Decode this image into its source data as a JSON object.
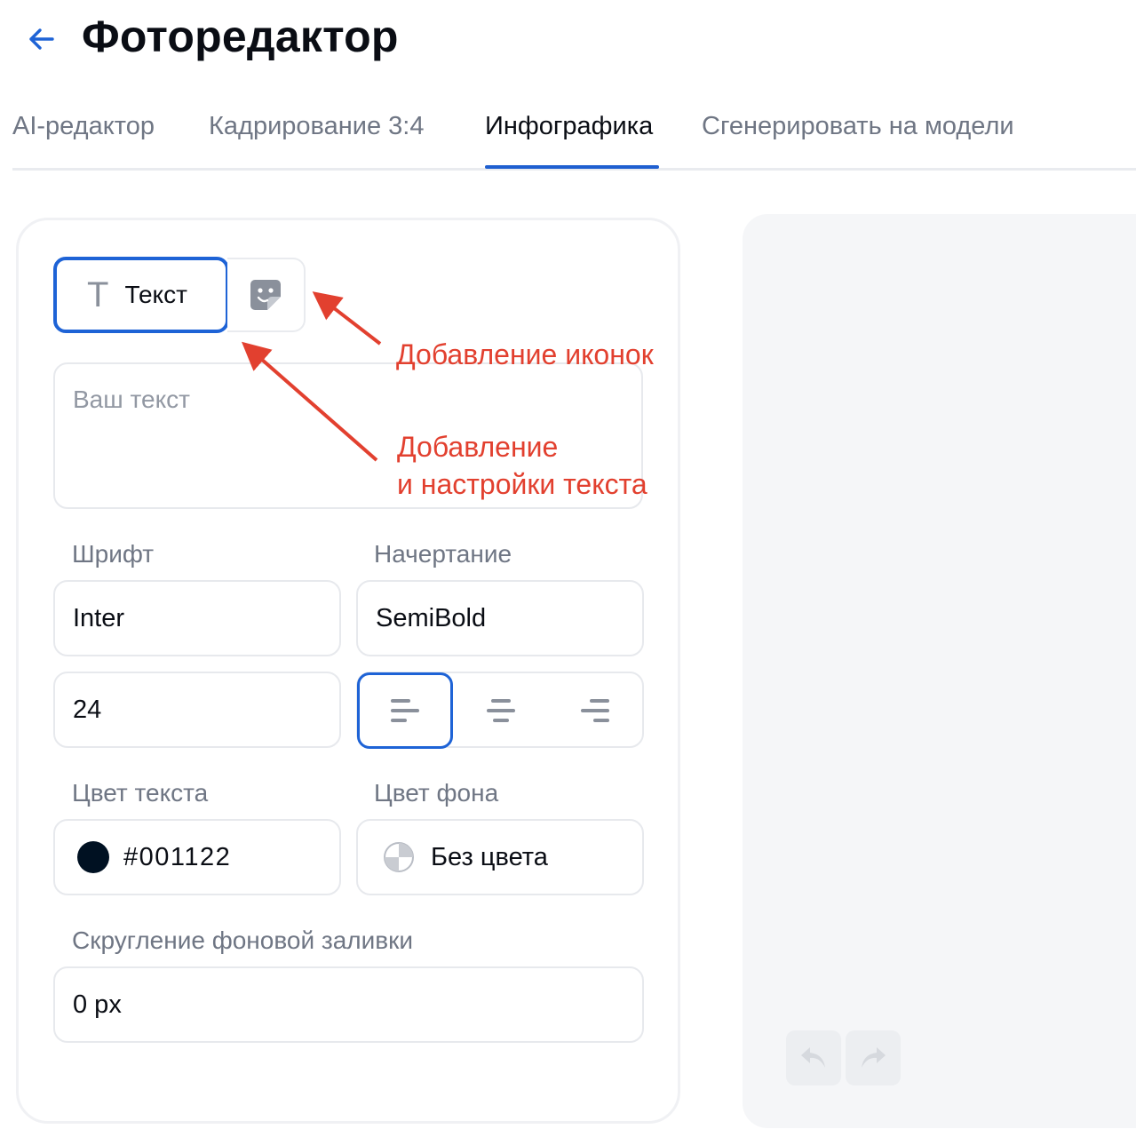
{
  "header": {
    "title": "Фоторедактор"
  },
  "tabs": [
    {
      "label": "AI-редактор",
      "active": false
    },
    {
      "label": "Кадрирование 3:4",
      "active": false
    },
    {
      "label": "Инфографика",
      "active": true
    },
    {
      "label": "Сгенерировать на модели",
      "active": false
    }
  ],
  "toolbar": {
    "text_tool_label": "Текст",
    "text_tool_icon": "T"
  },
  "text_input": {
    "placeholder": "Ваш текст",
    "value": ""
  },
  "font": {
    "label": "Шрифт",
    "value": "Inter"
  },
  "style": {
    "label": "Начертание",
    "value": "SemiBold"
  },
  "size": {
    "value": "24"
  },
  "alignment": {
    "options": [
      "left",
      "center",
      "right"
    ],
    "selected": "left"
  },
  "text_color": {
    "label": "Цвет текста",
    "value": "#001122",
    "swatch": "#001122"
  },
  "bg_color": {
    "label": "Цвет фона",
    "value": "Без цвета"
  },
  "radius": {
    "label": "Скругление фоновой заливки",
    "value": "0 px"
  },
  "annotations": {
    "icons": "Добавление иконок",
    "text_line1": "Добавление",
    "text_line2": "и настройки текста"
  },
  "colors": {
    "accent": "#1e63d6",
    "annotation": "#e2402f",
    "tab_underline": "#1f5fd0"
  },
  "icons": [
    "back-arrow-icon",
    "text-t-icon",
    "sticker-icon",
    "align-left-icon",
    "align-center-icon",
    "align-right-icon",
    "no-color-icon",
    "undo-icon",
    "redo-icon"
  ]
}
